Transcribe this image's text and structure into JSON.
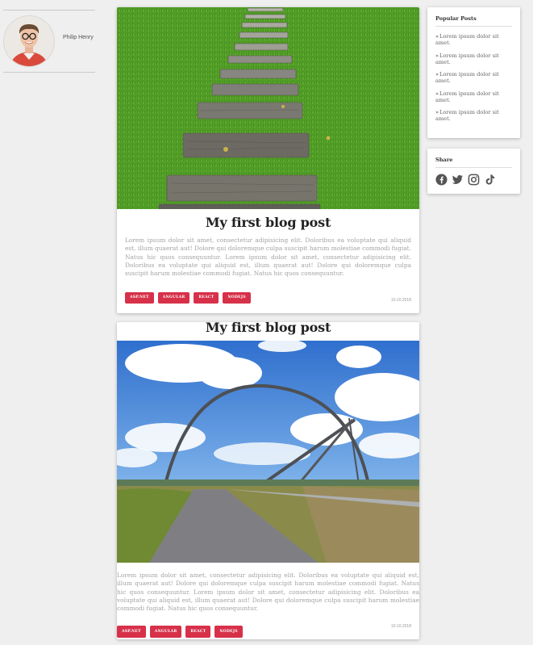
{
  "profile": {
    "name": "Philip Henry"
  },
  "posts": [
    {
      "title": "My first blog post",
      "body": "Lorem ipsum dolor sit amet, consectetur adipisicing elit. Doloribus ea voluptate qui aliquid est, illum quaerat aut! Dolore qui doloremque culpa suscipit harum molestiae commodi fugiat. Natus hic quos consequuntur. Lorem ipsum dolor sit amet, consectetur adipisicing elit. Doloribus ea voluptate qui aliquid est, illum quaerat aut! Dolore qui doloremque culpa suscipit harum molestiae commodi fugiat. Natus hic quos consequuntur.",
      "tags": [
        "ASP.NET",
        "ANGULAR",
        "REACT",
        "NODEJS"
      ],
      "date": "10.10.2018",
      "image": "stone-path-on-grass"
    },
    {
      "title": "My first blog post",
      "body": "Lorem ipsum dolor sit amet, consectetur adipisicing elit. Doloribus ea voluptate qui aliquid est, illum quaerat aut! Dolore qui doloremque culpa suscipit harum molestiae commodi fugiat. Natus hic quos consequuntur. Lorem ipsum dolor sit amet, consectetur adipisicing elit. Doloribus ea voluptate qui aliquid est, illum quaerat aut! Dolore qui doloremque culpa suscipit harum molestiae commodi fugiat. Natus hic quos consequuntur.",
      "tags": [
        "ASP.NET",
        "ANGULAR",
        "REACT",
        "NODEJS"
      ],
      "date": "10.10.2018",
      "image": "arch-sculpture-with-path"
    }
  ],
  "popular": {
    "title": "Popular Posts",
    "items": [
      "Lorem ipsum dolor sit amet.",
      "Lorem ipsum dolor sit amet.",
      "Lorem ipsum dolor sit amet.",
      "Lorem ipsum dolor sit amet.",
      "Lorem ipsum dolor sit amet."
    ]
  },
  "share": {
    "title": "Share",
    "icons": [
      "facebook-icon",
      "twitter-icon",
      "instagram-icon",
      "tiktok-icon"
    ]
  },
  "colors": {
    "tag": "#d7314a",
    "background": "#efefef"
  }
}
